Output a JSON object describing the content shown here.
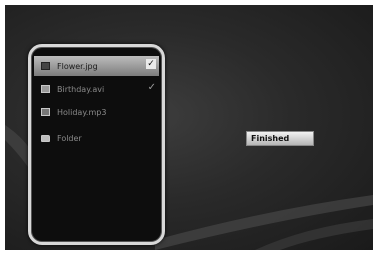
{
  "files": [
    {
      "name": "Flower.jpg",
      "icon": "image-file-icon",
      "checked": true,
      "selected": true
    },
    {
      "name": "Birthday.avi",
      "icon": "video-file-icon",
      "checked": true,
      "selected": false
    },
    {
      "name": "Holiday.mp3",
      "icon": "music-file-icon",
      "checked": false,
      "selected": false
    },
    {
      "name": "Folder",
      "icon": "folder-icon",
      "checked": false,
      "selected": false
    }
  ],
  "check_mark": "✓",
  "status_button": {
    "label": "Finished"
  }
}
